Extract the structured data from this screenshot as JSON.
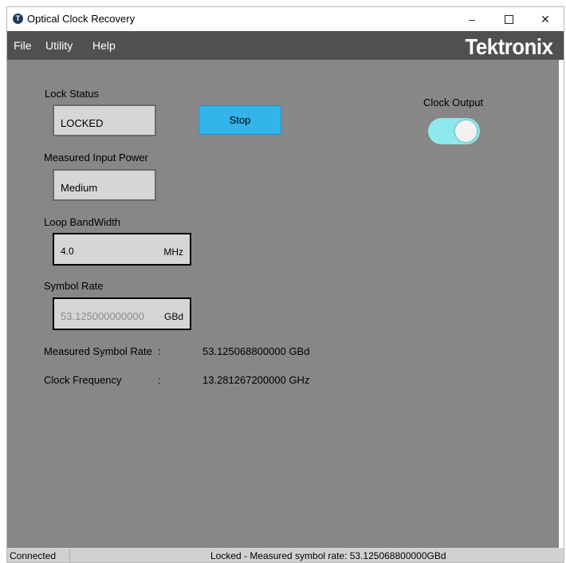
{
  "window": {
    "title": "Optical Clock Recovery",
    "app_icon_glyph": "T",
    "controls": {
      "minimize": "–",
      "close": "✕"
    }
  },
  "menu": {
    "items": [
      "File",
      "Utility",
      "Help"
    ],
    "logo": "Tektronix"
  },
  "lock_status": {
    "label": "Lock Status",
    "value": "LOCKED"
  },
  "stop_button": {
    "label": "Stop"
  },
  "clock_output": {
    "label": "Clock Output",
    "enabled": true
  },
  "input_power": {
    "label": "Measured Input Power",
    "value": "Medium"
  },
  "loop_bandwidth": {
    "label": "Loop BandWidth",
    "value": "4.0",
    "unit": "MHz"
  },
  "symbol_rate": {
    "label": "Symbol Rate",
    "value": "53.125000000000",
    "unit": "GBd"
  },
  "measured_symbol_rate": {
    "label": "Measured Symbol Rate",
    "separator": ":",
    "value": "53.125068800000 GBd"
  },
  "clock_frequency": {
    "label": "Clock Frequency",
    "separator": ":",
    "value": "13.281267200000 GHz"
  },
  "status_bar": {
    "connection": "Connected",
    "message": "Locked - Measured symbol rate: 53.125068800000GBd"
  },
  "colors": {
    "menubar": "#505050",
    "content_bg": "#878787",
    "stop_button": "#33b5ea",
    "toggle_on": "#8fe8ec",
    "field_bg": "#d6d6d6"
  }
}
